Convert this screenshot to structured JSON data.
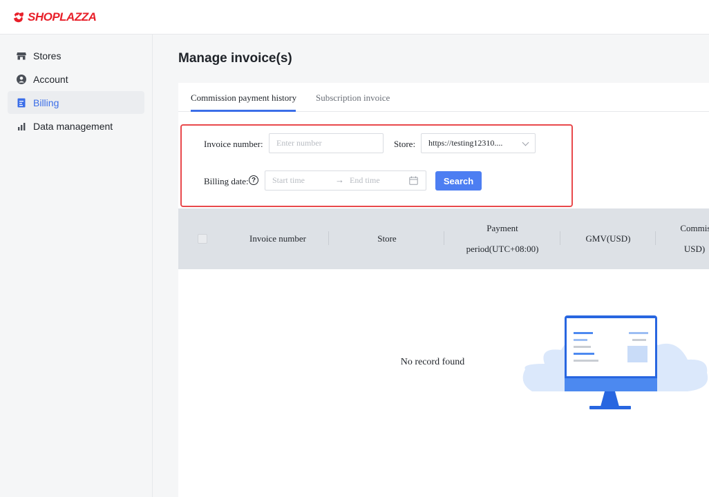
{
  "header": {
    "brand": "SHOPLAZZA",
    "brand_color": "#e8202a"
  },
  "sidebar": {
    "items": [
      {
        "label": "Stores",
        "icon": "store-icon",
        "active": false
      },
      {
        "label": "Account",
        "icon": "user-icon",
        "active": false
      },
      {
        "label": "Billing",
        "icon": "billing-icon",
        "active": true
      },
      {
        "label": "Data management",
        "icon": "bar-chart-icon",
        "active": false
      }
    ]
  },
  "main": {
    "title": "Manage invoice(s)",
    "tabs": [
      {
        "label": "Commission payment history",
        "active": true
      },
      {
        "label": "Subscription invoice",
        "active": false
      }
    ],
    "filters": {
      "invoice_label": "Invoice number:",
      "invoice_placeholder": "Enter number",
      "store_label": "Store:",
      "store_value": "https://testing12310....",
      "billing_label": "Billing date:",
      "start_placeholder": "Start time",
      "end_placeholder": "End time",
      "search_label": "Search"
    },
    "table": {
      "columns": [
        "Invoice number",
        "Store",
        "Payment period(UTC+08:00)",
        "GMV(USD)",
        "Commission(USD)"
      ],
      "col_lines": [
        [
          "Invoice number"
        ],
        [
          "Store"
        ],
        [
          "Payment",
          "period(UTC+08:00)"
        ],
        [
          "GMV(USD)"
        ],
        [
          "Commissio",
          "USD)"
        ]
      ]
    },
    "empty_text": "No record found",
    "accent_color": "#3b6ee8"
  }
}
